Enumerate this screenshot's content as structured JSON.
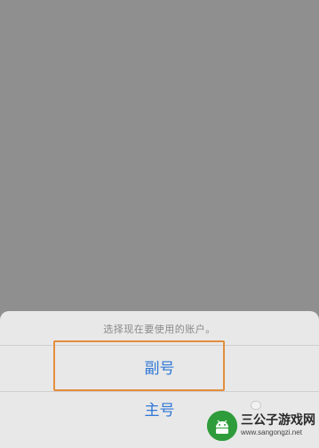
{
  "sheet": {
    "title": "选择现在要使用的账户。",
    "options": [
      {
        "label": "副号"
      },
      {
        "label": "主号"
      }
    ]
  },
  "watermark": {
    "brand": "三公子游戏网",
    "url": "www.sangongzi.net"
  },
  "colors": {
    "backdrop": "#8f8f8f",
    "sheet": "#e8e8e8",
    "option_text": "#2f78d6",
    "highlight": "#e38d3d"
  }
}
